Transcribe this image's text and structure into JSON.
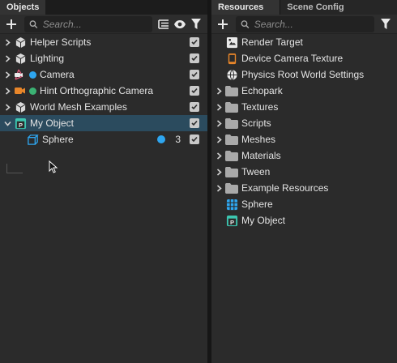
{
  "colors": {
    "accent": "#2ea6f0",
    "selection": "#2b4b5e",
    "panel": "#2b2b2b",
    "camera_dot": "#2ea6f0",
    "ortho_dot": "#3bb273"
  },
  "objects_panel": {
    "tab_label": "Objects",
    "search_placeholder": "Search...",
    "toolbar_icons": [
      "plus-icon",
      "search-icon",
      "hierarchy-list-icon",
      "eye-icon",
      "filter-icon"
    ],
    "items": [
      {
        "label": "Helper Scripts",
        "icon": "cube-icon",
        "expandable": true,
        "checked": true
      },
      {
        "label": "Lighting",
        "icon": "cube-icon",
        "expandable": true,
        "checked": true
      },
      {
        "label": "Camera",
        "icon": "camera-icon",
        "expandable": true,
        "checked": true,
        "dot": "blue"
      },
      {
        "label": "Hint Orthographic Camera",
        "icon": "ortho-camera-icon",
        "expandable": true,
        "checked": true,
        "dot": "green"
      },
      {
        "label": "World Mesh Examples",
        "icon": "cube-icon",
        "expandable": true,
        "checked": true
      },
      {
        "label": "My Object",
        "icon": "prefab-icon",
        "expandable": true,
        "expanded": true,
        "selected": true,
        "checked": true
      },
      {
        "label": "Sphere",
        "icon": "mesh-icon",
        "expandable": false,
        "checked": true,
        "count": "3",
        "indent": 1
      }
    ]
  },
  "resources_panel": {
    "tab_label": "Resources",
    "tab2_label": "Scene Config",
    "search_placeholder": "Search...",
    "items": [
      {
        "label": "Render Target",
        "icon": "render-target-icon",
        "expandable": false
      },
      {
        "label": "Device Camera Texture",
        "icon": "device-camera-icon",
        "expandable": false
      },
      {
        "label": "Physics Root World Settings",
        "icon": "physics-globe-icon",
        "expandable": false
      },
      {
        "label": "Echopark",
        "icon": "folder-icon",
        "expandable": true
      },
      {
        "label": "Textures",
        "icon": "folder-icon",
        "expandable": true
      },
      {
        "label": "Scripts",
        "icon": "folder-icon",
        "expandable": true
      },
      {
        "label": "Meshes",
        "icon": "folder-icon",
        "expandable": true
      },
      {
        "label": "Materials",
        "icon": "folder-icon",
        "expandable": true
      },
      {
        "label": "Tween",
        "icon": "folder-icon",
        "expandable": true
      },
      {
        "label": "Example Resources",
        "icon": "folder-icon",
        "expandable": true
      },
      {
        "label": "Sphere",
        "icon": "sphere-mesh-icon",
        "expandable": false
      },
      {
        "label": "My Object",
        "icon": "prefab-icon",
        "expandable": false
      }
    ]
  }
}
